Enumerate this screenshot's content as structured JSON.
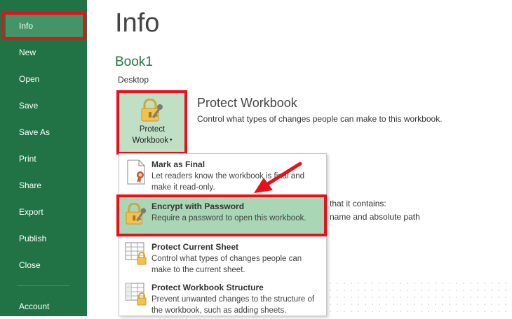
{
  "sidebar": {
    "items": [
      {
        "label": "Info",
        "active": true
      },
      {
        "label": "New"
      },
      {
        "label": "Open"
      },
      {
        "label": "Save"
      },
      {
        "label": "Save As"
      },
      {
        "label": "Print"
      },
      {
        "label": "Share"
      },
      {
        "label": "Export"
      },
      {
        "label": "Publish"
      },
      {
        "label": "Close"
      }
    ],
    "account_label": "Account"
  },
  "main": {
    "title": "Info",
    "book_name": "Book1",
    "location": "Desktop",
    "protect_button": {
      "line1": "Protect",
      "line2": "Workbook",
      "icon": "lock-key-icon"
    },
    "protect_section": {
      "title": "Protect Workbook",
      "description": "Control what types of changes people can make to this workbook."
    },
    "background_text": {
      "line1": "that it contains:",
      "line2": "name and absolute path"
    }
  },
  "protect_menu": {
    "items": [
      {
        "title": "Mark as Final",
        "description": "Let readers know the workbook is final and make it read-only.",
        "icon": "final-document-icon"
      },
      {
        "title": "Encrypt with Password",
        "description": "Require a password to open this workbook.",
        "icon": "lock-key-icon",
        "highlighted": true
      },
      {
        "title": "Protect Current Sheet",
        "description": "Control what types of changes people can make to the current sheet.",
        "icon": "sheet-lock-icon"
      },
      {
        "title": "Protect Workbook Structure",
        "description": "Prevent unwanted changes to the structure of the workbook, such as adding sheets.",
        "icon": "workbook-structure-lock-icon"
      }
    ]
  },
  "colors": {
    "sidebar": "#217346",
    "active_item": "#439467",
    "highlight_box": "#e8101a",
    "menu_highlight": "#a9d6b4"
  }
}
